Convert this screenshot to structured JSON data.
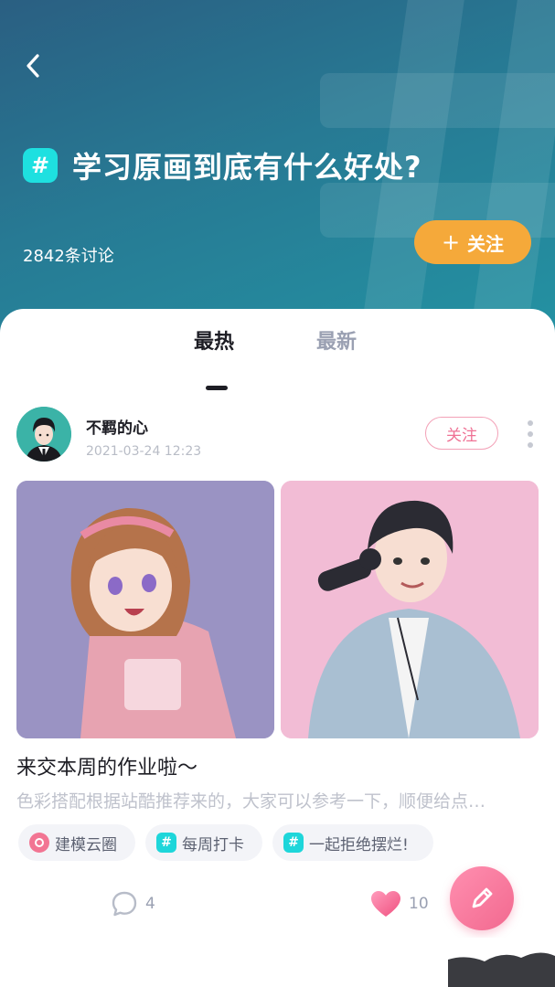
{
  "header": {
    "topic_symbol": "#",
    "title": "学习原画到底有什么好处?",
    "discussion_count": "2842条讨论",
    "follow_plus": "+",
    "follow_label": "关注",
    "colors": {
      "gradient_start": "#2a5f82",
      "gradient_end": "#2393a3",
      "follow_bg": "#f5a93a",
      "tag_bg": "#1ee0e0"
    }
  },
  "tabs": [
    {
      "label": "最热",
      "active": true
    },
    {
      "label": "最新",
      "active": false
    }
  ],
  "post": {
    "author": "不羁的心",
    "time": "2021-03-24   12:23",
    "follow_label": "关注",
    "title": "来交本周的作业啦～",
    "description": "色彩搭配根据站酷推荐来的，大家可以参考一下，顺便给点…",
    "tags": [
      {
        "icon": "circle-ring-icon",
        "symbol": "",
        "label": "建模云圈"
      },
      {
        "icon": "hash-tag-icon",
        "symbol": "#",
        "label": "每周打卡"
      },
      {
        "icon": "hash-tag-icon",
        "symbol": "#",
        "label": "一起拒绝摆烂!"
      }
    ],
    "comment_count": "4",
    "like_count": "10"
  },
  "icons": {
    "back": "back-arrow-icon",
    "comment": "comment-bubble-icon",
    "like": "heart-icon",
    "compose": "pencil-icon",
    "more": "more-vertical-icon"
  }
}
